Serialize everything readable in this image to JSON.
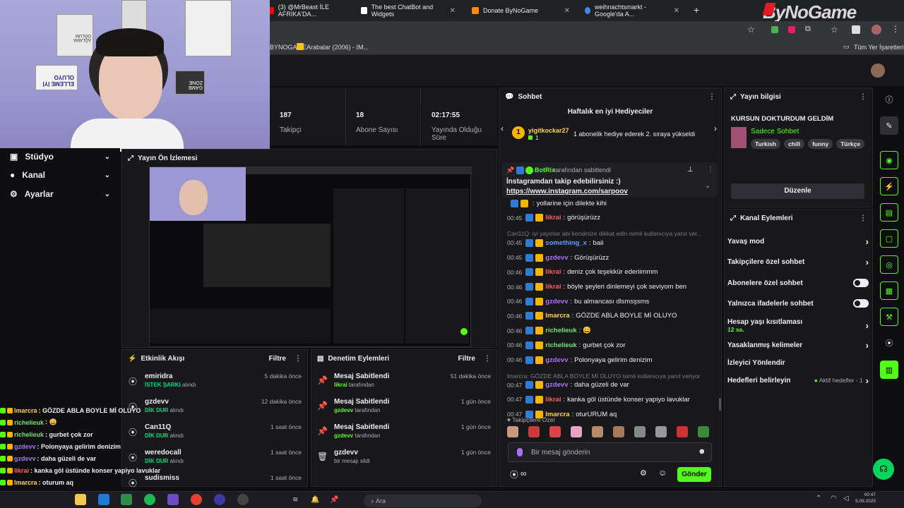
{
  "browser": {
    "tabs": [
      {
        "label": "(3) @MrBeast İLE AFRİKA'DA...",
        "color": "#ff0000"
      },
      {
        "label": "The best ChatBot and Widgets",
        "color": "#ffffff"
      },
      {
        "label": "Donate ByNoGame",
        "color": "#ff8a00"
      },
      {
        "label": "weihnachtsmarkt - Google'da A...",
        "color": "#4285f4"
      }
    ],
    "new_tab": "+",
    "bookmarks": [
      {
        "label": "BYNOGAME"
      },
      {
        "label": "Arabalar (2006) - IM..."
      }
    ],
    "all_bookmarks": "Tüm Yer İşaretleri"
  },
  "brand_watermark": "ByNoGame",
  "stats": {
    "items": [
      {
        "value": "187",
        "label": "Takipçi"
      },
      {
        "value": "18",
        "label": "Abone Sayısı"
      },
      {
        "value": "02:17:55",
        "label": "Yayında Olduğu Süre"
      }
    ]
  },
  "left_menu": [
    {
      "label": "Stüdyo",
      "icon": "studio-icon"
    },
    {
      "label": "Kanal",
      "icon": "channel-icon"
    },
    {
      "label": "Ayarlar",
      "icon": "settings-icon"
    }
  ],
  "preview": {
    "title": "Yayın Ön İzlemesi"
  },
  "activity": {
    "title": "Etkinlik Akışı",
    "filter": "Filtre",
    "items": [
      {
        "name": "emiridra",
        "action": "İSTEK ŞARKI",
        "suffix": "alındı",
        "time": "5 dakika önce"
      },
      {
        "name": "gzdevv",
        "action": "DİK DUR",
        "suffix": "alındı",
        "time": "12 dakika önce"
      },
      {
        "name": "Can11Q",
        "action": "DİK DUR",
        "suffix": "alındı",
        "time": "1 saat önce"
      },
      {
        "name": "weredocall",
        "action": "DİK DUR",
        "suffix": "alındı",
        "time": "1 saat önce"
      },
      {
        "name": "sudismiss",
        "action": "",
        "suffix": "",
        "time": "1 saat önce"
      }
    ]
  },
  "moderation": {
    "title": "Denetim Eylemleri",
    "filter": "Filtre",
    "items": [
      {
        "title": "Mesaj Sabitlendi",
        "user": "likrai",
        "suffix": "tarafından",
        "time": "51 dakika önce",
        "icon": "pin-icon"
      },
      {
        "title": "Mesaj Sabitlendi",
        "user": "gzdevv",
        "suffix": "tarafından",
        "time": "1 gün önce",
        "icon": "pin-icon"
      },
      {
        "title": "Mesaj Sabitlendi",
        "user": "gzdevv",
        "suffix": "tarafından",
        "time": "1 gün önce",
        "icon": "pin-icon"
      },
      {
        "title": "gzdevv",
        "user": "",
        "suffix": "bir mesajı sildi",
        "time": "1 gün önce",
        "icon": "trash-icon"
      }
    ]
  },
  "chat": {
    "title": "Sohbet",
    "top_gifters": "Haftalık en iyi Hediyeciler",
    "gifter": {
      "rank": "1",
      "name": "yigitkockar27",
      "count": "1",
      "message": "1 abonelik hediye ederek 2. sıraya yükseldi"
    },
    "pinned": {
      "by": "BotRix",
      "by_suffix": "tarafından sabitlendi",
      "text": "İnstagramdan takip edebilirsiniz :)",
      "link": "https://www.instagram.com/sarpoov"
    },
    "messages": [
      {
        "time": "",
        "user": "",
        "color": "#ff5c5c",
        "text": "yollarine için dilekte kihi"
      },
      {
        "time": "00:45",
        "user": "likrai",
        "color": "#ff5c5c",
        "text": "görüşürüzz"
      },
      {
        "reply": "Can11Q: iyi yayinlar abi kendinize dikkat edin isimli kullanıcıya yanıt ver..."
      },
      {
        "time": "00:45",
        "user": "something_x",
        "color": "#5c9cff",
        "text": "baii"
      },
      {
        "time": "00:45",
        "user": "gzdevv",
        "color": "#a970ff",
        "text": "Görüşürüzz"
      },
      {
        "time": "00:46",
        "user": "likrai",
        "color": "#ff5c5c",
        "text": "deniz çok teşekkür ederiimmm"
      },
      {
        "time": "00:46",
        "user": "likrai",
        "color": "#ff5c5c",
        "text": "böyle şeyleri dinlemeyi çok seviyom ben"
      },
      {
        "time": "00:46",
        "user": "gzdevv",
        "color": "#a970ff",
        "text": "bu almancası dlsmsşsms"
      },
      {
        "time": "00:46",
        "user": "lmarcra",
        "color": "#ffd24d",
        "text": "GÖZDE ABLA BOYLE Mİ OLUYO"
      },
      {
        "time": "00:46",
        "user": "richelieuk",
        "color": "#6ee36e",
        "text": "😀"
      },
      {
        "time": "00:46",
        "user": "richelieuk",
        "color": "#6ee36e",
        "text": "gurbet çok zor"
      },
      {
        "time": "00:46",
        "user": "gzdevv",
        "color": "#a970ff",
        "text": "Polonyaya gelirim denizim"
      },
      {
        "reply": "lmarcra: GÖZDE ABLA BOYLE Mİ OLUYO isimli kullanıcıya yanıt veriyor"
      },
      {
        "time": "00:47",
        "user": "gzdevv",
        "color": "#a970ff",
        "text": "daha güzeli de var"
      },
      {
        "time": "00:47",
        "user": "likrai",
        "color": "#ff5c5c",
        "text": "kanka göl üstünde konser yapiyo lavuklar"
      },
      {
        "time": "00:47",
        "user": "lmarcra",
        "color": "#ffd24d",
        "text": "oturURUM aq"
      }
    ],
    "followers_only": "Takipçilere Özel",
    "input_placeholder": "Bir mesaj gönderin",
    "send": "Gönder"
  },
  "stream_info": {
    "title": "Yayın bilgisi",
    "stream_title": "KURSUN DOKTURDUM GELDİM",
    "category": "Sadece Sohbet",
    "tags": [
      "Turkish",
      "chill",
      "funny",
      "Türkçe"
    ],
    "edit": "Düzenle"
  },
  "channel_actions": {
    "title": "Kanal Eylemleri",
    "items": [
      {
        "label": "Yavaş mod",
        "control": "arrow"
      },
      {
        "label": "Takipçilere özel sohbet",
        "control": "arrow"
      },
      {
        "label": "Abonelere özel sohbet",
        "control": "toggle"
      },
      {
        "label": "Yalnızca ifadelerle sohbet",
        "control": "toggle"
      },
      {
        "label": "Hesap yaşı kısıtlaması",
        "sub": "12 sa.",
        "control": "arrow"
      },
      {
        "label": "Yasaklanmış kelimeler",
        "control": "arrow"
      },
      {
        "label": "İzleyici Yönlendir",
        "control": "none"
      },
      {
        "label": "Hedefleri belirleyin",
        "extra": "Aktif hedefler - 1",
        "control": "arrow"
      }
    ]
  },
  "overlay_chat": [
    {
      "user": "lmarcra",
      "color": "#ffd24d",
      "text": ": GÖZDE ABLA BOYLE Mİ OLUYO"
    },
    {
      "user": "richelieuk",
      "color": "#6ee36e",
      "text": ": 😀"
    },
    {
      "user": "richelieuk",
      "color": "#6ee36e",
      "text": ": gurbet çok zor"
    },
    {
      "user": "gzdevv",
      "color": "#a970ff",
      "text": ": Polonyaya gelirim denizim"
    },
    {
      "user": "gzdevv",
      "color": "#a970ff",
      "text": ": daha güzeli de var"
    },
    {
      "user": "likrai",
      "color": "#ff5c5c",
      "text": ": kanka göl üstünde konser yapiyo lavuklar"
    },
    {
      "user": "lmarcra",
      "color": "#ffd24d",
      "text": ": oturum aq"
    }
  ],
  "taskbar": {
    "search": "Ara",
    "time": "00:47",
    "date": "5.09.2025"
  },
  "poster_texts": {
    "left": "ELLEME İYİ OLUYO",
    "right": "GAME ZONE",
    "top": "AĞLAMA OĞLUM"
  },
  "colors": {
    "accent": "#53fc18",
    "bg": "#0e0e10",
    "panel": "#18181b"
  }
}
